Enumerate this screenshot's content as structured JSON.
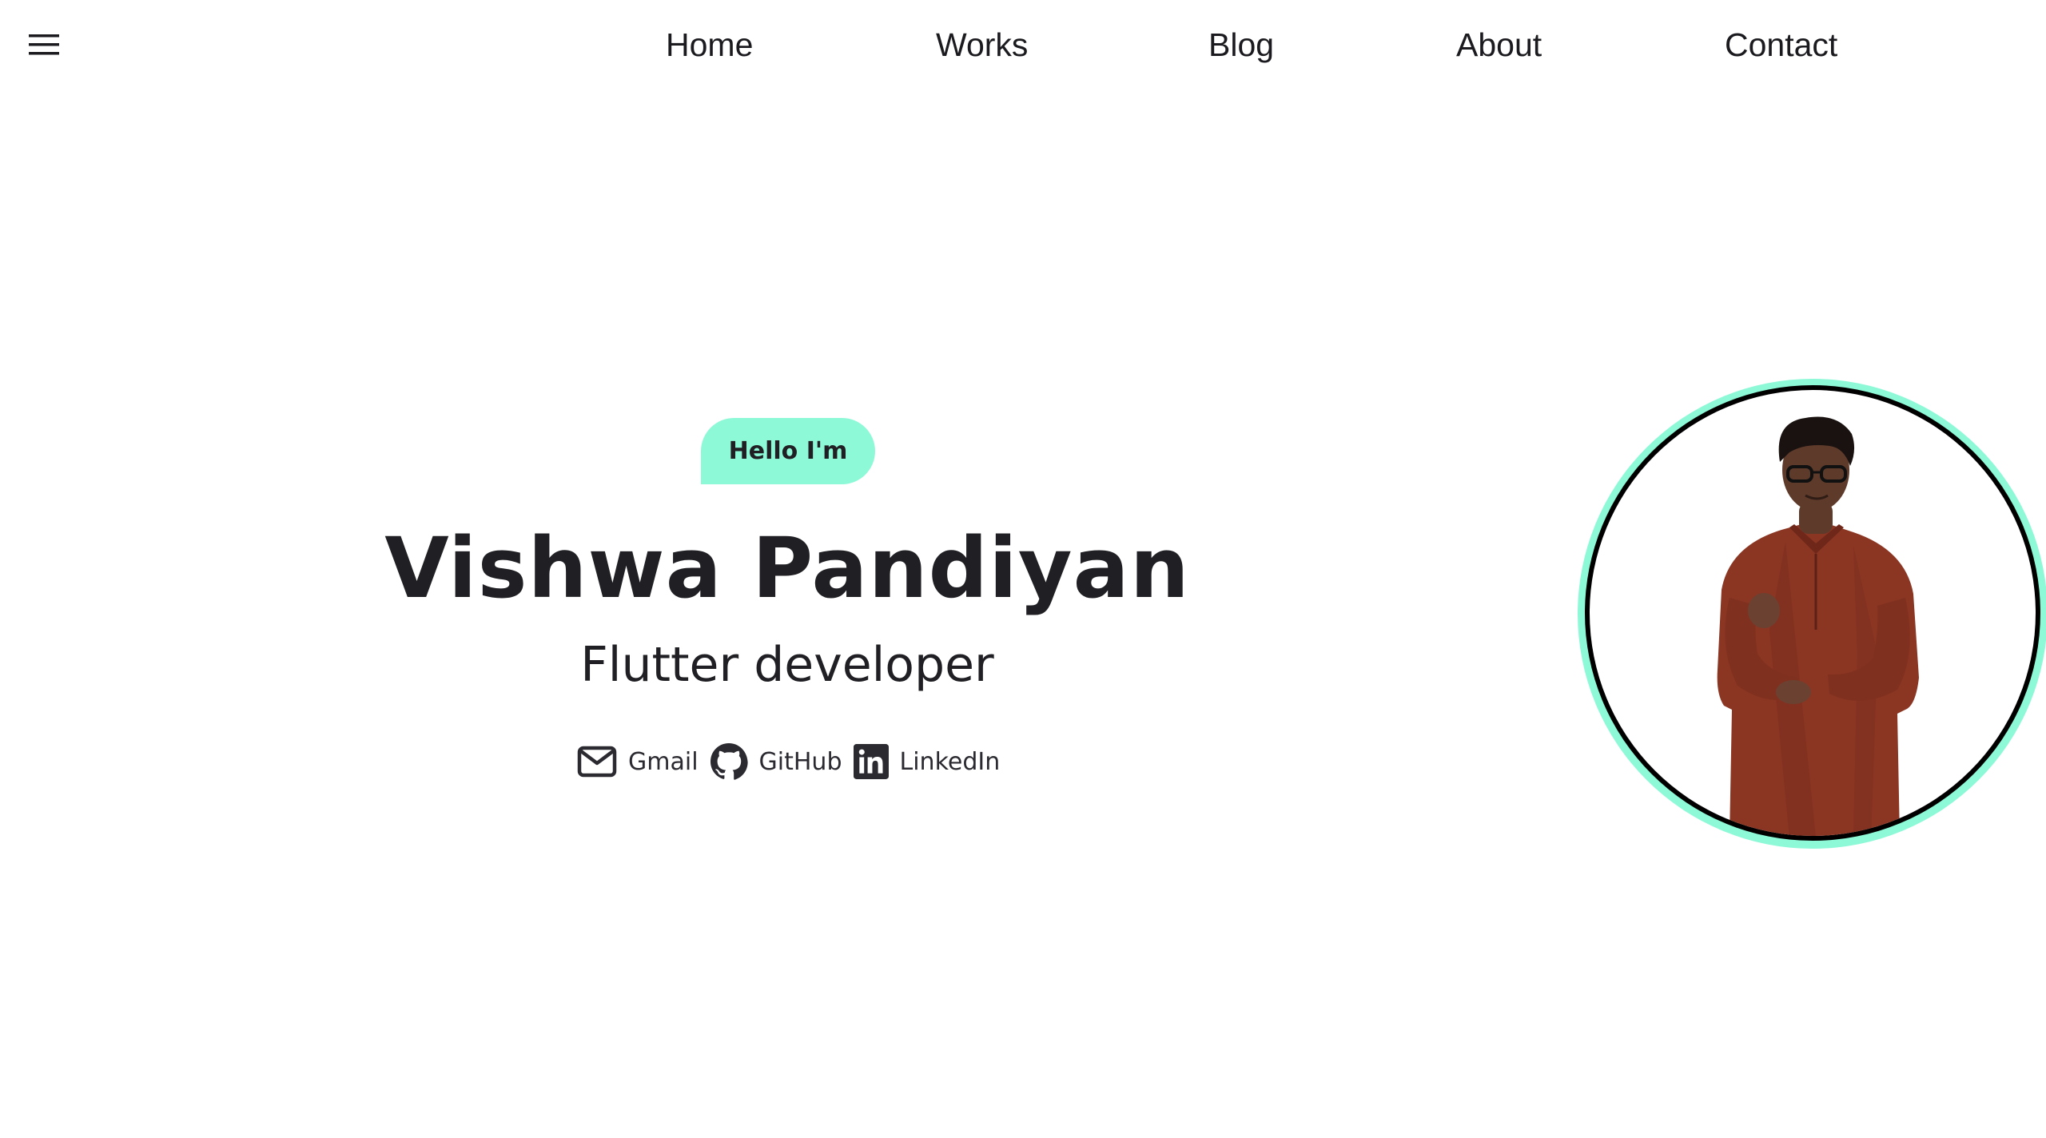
{
  "nav": {
    "menu_icon": "hamburger-menu-icon",
    "items": [
      {
        "label": "Home"
      },
      {
        "label": "Works"
      },
      {
        "label": "Blog"
      },
      {
        "label": "About"
      },
      {
        "label": "Contact"
      }
    ]
  },
  "hero": {
    "greeting": "Hello I'm",
    "name": "Vishwa Pandiyan",
    "role": "Flutter developer",
    "socials": [
      {
        "label": "Gmail",
        "icon": "mail-icon"
      },
      {
        "label": "GitHub",
        "icon": "github-icon"
      },
      {
        "label": "LinkedIn",
        "icon": "linkedin-icon"
      }
    ]
  },
  "portrait": {
    "ring_color": "#8ef9d7",
    "border_color": "#000000"
  },
  "colors": {
    "accent": "#8ef9d7",
    "text": "#1f1f24",
    "background": "#ffffff"
  }
}
